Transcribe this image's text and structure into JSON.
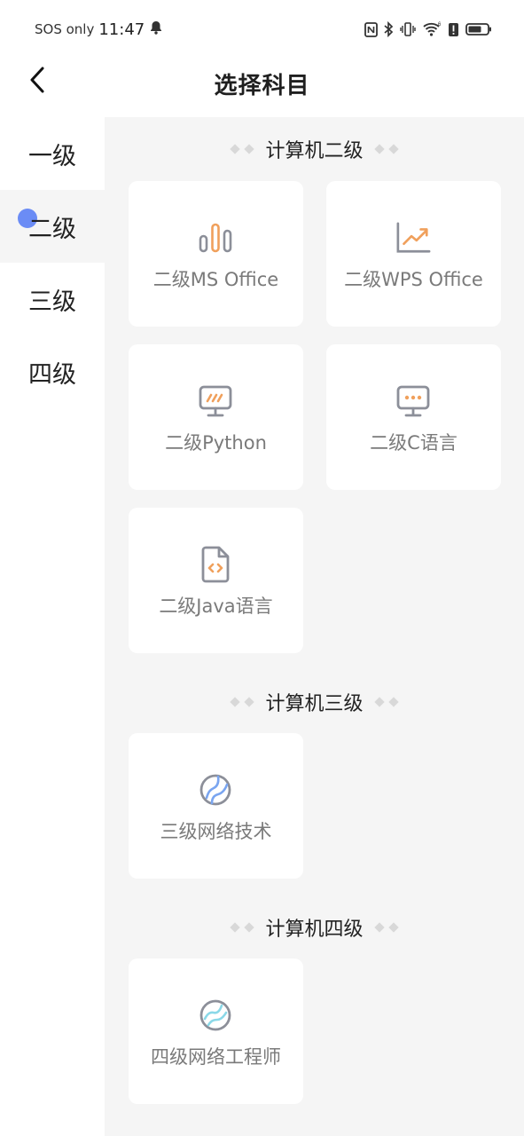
{
  "status_bar": {
    "sos": "SOS only",
    "time": "11:47",
    "icons": [
      "bell-icon",
      "nfc-icon",
      "bluetooth-icon",
      "vibrate-icon",
      "wifi-icon",
      "battery-alert-icon",
      "battery-icon"
    ]
  },
  "header": {
    "back_icon": "chevron-left-icon",
    "title": "选择科目"
  },
  "sidebar": {
    "items": [
      {
        "label": "一级",
        "active": false
      },
      {
        "label": "二级",
        "active": true
      },
      {
        "label": "三级",
        "active": false
      },
      {
        "label": "四级",
        "active": false
      }
    ],
    "active_dot_color": "#6b8cf5"
  },
  "sections": [
    {
      "title": "计算机二级",
      "cards": [
        {
          "label": "二级MS Office",
          "icon": "bar-chart-icon"
        },
        {
          "label": "二级WPS Office",
          "icon": "line-chart-icon"
        },
        {
          "label": "二级Python",
          "icon": "monitor-slash-icon"
        },
        {
          "label": "二级C语言",
          "icon": "monitor-dots-icon"
        },
        {
          "label": "二级Java语言",
          "icon": "code-file-icon"
        }
      ]
    },
    {
      "title": "计算机三级",
      "cards": [
        {
          "label": "三级网络技术",
          "icon": "globe-network-icon"
        }
      ]
    },
    {
      "title": "计算机四级",
      "cards": [
        {
          "label": "四级网络工程师",
          "icon": "globe-wave-icon"
        }
      ]
    }
  ],
  "colors": {
    "accent_orange": "#f0a05c",
    "icon_gray": "#8c8f99",
    "accent_blue": "#7aa5f0",
    "accent_cyan": "#8ad8e8",
    "background": "#f5f5f5"
  }
}
